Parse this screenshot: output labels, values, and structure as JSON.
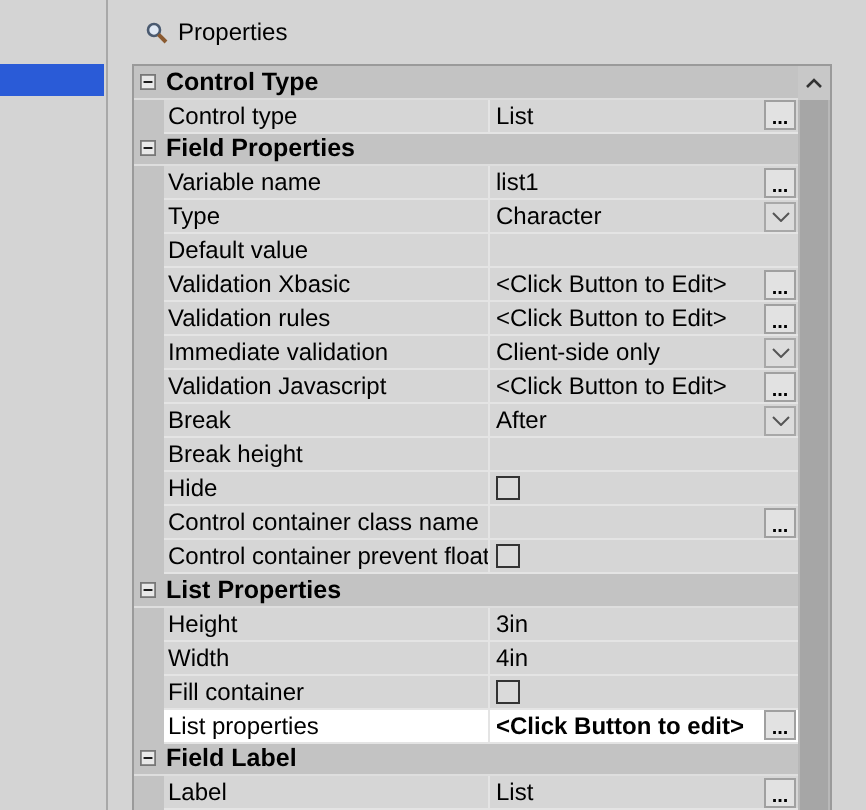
{
  "sidebar": {
    "items": [
      {
        "selected": true
      }
    ]
  },
  "panel": {
    "title": "Properties"
  },
  "sections": [
    {
      "title": "Control Type",
      "expanded": true,
      "rows": [
        {
          "name": "Control type",
          "value": "List",
          "kind": "button",
          "button": "...",
          "selected": false
        }
      ]
    },
    {
      "title": "Field Properties",
      "expanded": true,
      "rows": [
        {
          "name": "Variable name",
          "value": "list1",
          "kind": "button",
          "button": "...",
          "selected": false
        },
        {
          "name": "Type",
          "value": "Character",
          "kind": "dropdown",
          "selected": false
        },
        {
          "name": "Default value",
          "kind": "text",
          "selected": false
        },
        {
          "name": "Validation Xbasic",
          "value": "<Click Button to Edit>",
          "kind": "button",
          "button": "...",
          "selected": false
        },
        {
          "name": "Validation rules",
          "value": "<Click Button to Edit>",
          "kind": "button",
          "button": "...",
          "selected": false
        },
        {
          "name": "Immediate validation",
          "value": "Client-side only",
          "kind": "dropdown",
          "selected": false
        },
        {
          "name": "Validation Javascript",
          "value": "<Click Button to Edit>",
          "kind": "button",
          "button": "...",
          "selected": false
        },
        {
          "name": "Break",
          "value": "After",
          "kind": "dropdown",
          "selected": false
        },
        {
          "name": "Break height",
          "kind": "text",
          "selected": false
        },
        {
          "name": "Hide",
          "kind": "checkbox",
          "checked": false,
          "selected": false
        },
        {
          "name": "Control container class name",
          "kind": "button",
          "button": "...",
          "selected": false
        },
        {
          "name": "Control container prevent float",
          "kind": "checkbox",
          "checked": false,
          "selected": false
        }
      ]
    },
    {
      "title": "List Properties",
      "expanded": true,
      "rows": [
        {
          "name": "Height",
          "value": "3in",
          "kind": "text",
          "selected": false
        },
        {
          "name": "Width",
          "value": "4in",
          "kind": "text",
          "selected": false
        },
        {
          "name": "Fill container",
          "kind": "checkbox",
          "checked": false,
          "selected": false
        },
        {
          "name": "List properties",
          "value": "<Click Button to edit>",
          "kind": "button",
          "button": "...",
          "selected": true
        }
      ]
    },
    {
      "title": "Field Label",
      "expanded": true,
      "rows": [
        {
          "name": "Label",
          "value": "List",
          "kind": "button",
          "button": "...",
          "selected": false
        }
      ]
    }
  ]
}
